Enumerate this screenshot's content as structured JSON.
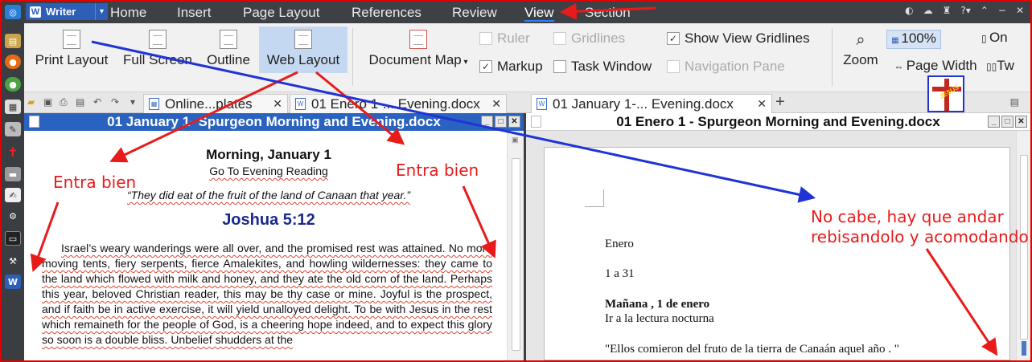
{
  "topbar": {
    "writer_label": "Writer",
    "menus": [
      "Home",
      "Insert",
      "Page Layout",
      "References",
      "Review",
      "View",
      "Section"
    ],
    "active_menu": "View"
  },
  "ribbon": {
    "print_layout": "Print Layout",
    "full_screen": "Full Screen",
    "outline": "Outline",
    "web_layout": "Web Layout",
    "document_map": "Document Map",
    "checks": {
      "ruler": "Ruler",
      "gridlines": "Gridlines",
      "show_view_gridlines": "Show View Gridlines",
      "markup": "Markup",
      "task_window": "Task Window",
      "navigation_pane": "Navigation Pane"
    },
    "zoom": "Zoom",
    "zoom_value": "100%",
    "page_width": "Page Width",
    "one_page": "On",
    "two_pages": "Tw"
  },
  "tabs": {
    "tab1": "Online...plates",
    "tab2": "01 Enero 1-... Evening.docx",
    "tab3": "01 January 1-... Evening.docx",
    "add": "+"
  },
  "left_window": {
    "title": "01 January 1- Spurgeon Morning and Evening.docx",
    "heading": "Morning, January 1",
    "link": "Go To Evening Reading",
    "quote": "“They did eat of the fruit of the land of Canaan that year.”",
    "ref": "Joshua 5:12",
    "body": "Israel’s weary wanderings were all over, and the promised rest was attained. No more moving tents, fiery serpents, fierce Amalekites, and howling wildernesses: they came to the land which flowed with milk and honey, and they ate the old corn of the land. Perhaps this year, beloved Christian reader, this may be thy case or mine. Joyful is the prospect, and if faith be in active exercise, it will yield unalloyed delight. To be with Jesus in the rest which remaineth for the people of God, is a cheering hope indeed, and to expect this glory so soon is a double bliss. Unbelief shudders at the"
  },
  "right_window": {
    "title": "01 Enero 1 - Spurgeon Morning and Evening.docx",
    "line1": "Enero",
    "line2": "1 a 31",
    "line3": "Mañana , 1 de enero",
    "line4": "Ir a la lectura nocturna",
    "line5": "\"Ellos comieron del fruto de la tierra de Canaán aquel año . \""
  },
  "annotations": {
    "left": "Entra bien",
    "mid": "Entra bien",
    "right_line1": "No cabe, hay que andar",
    "right_line2": "rebisandolo y acomodando"
  },
  "sticker_text": "JESÚS",
  "colors": {
    "annotation_red": "#e81b1b",
    "annotation_blue": "#1f33d6",
    "title_blue": "#2a63bf",
    "accent": "#2c5fb5"
  }
}
